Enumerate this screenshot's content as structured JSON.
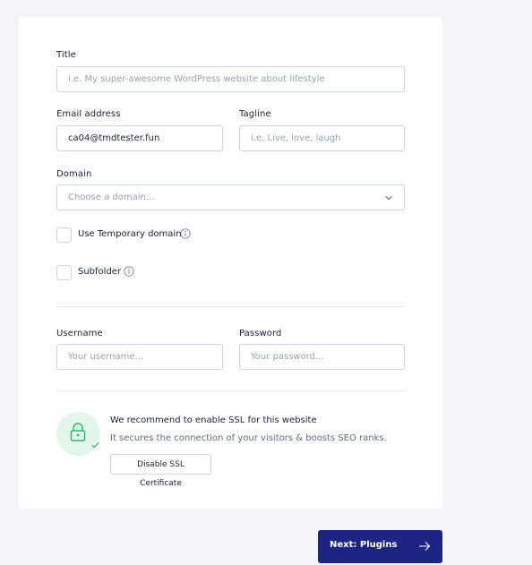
{
  "form": {
    "title_label": "Title",
    "title_placeholder": "i.e. My super-awesome WordPress website about lifestyle",
    "email_label": "Email address",
    "email_value": "ca04@tmdtester.fun",
    "tagline_label": "Tagline",
    "tagline_placeholder": "i.e. Live, love, laugh",
    "domain_label": "Domain",
    "domain_placeholder": "Choose a domain...",
    "temp_domain_label": "Use Temporary domain",
    "subfolder_label": "Subfolder",
    "username_label": "Username",
    "username_placeholder": "Your username...",
    "password_label": "Password",
    "password_placeholder": "Your password..."
  },
  "ssl": {
    "title": "We recommend to enable SSL for this website",
    "subtitle": "It secures the connection of your visitors & boosts SEO ranks.",
    "button_label": "Disable SSL Certificate"
  },
  "footer": {
    "next_label": "Next: Plugins"
  },
  "colors": {
    "primary": "#1e2482",
    "ssl_green": "#2fb36b",
    "ssl_bg": "#e3f6ea"
  },
  "icons": {
    "info": "info-icon",
    "chevron": "chevron-down-icon",
    "lock": "lock-icon",
    "check": "check-icon",
    "arrow": "arrow-right-icon"
  }
}
